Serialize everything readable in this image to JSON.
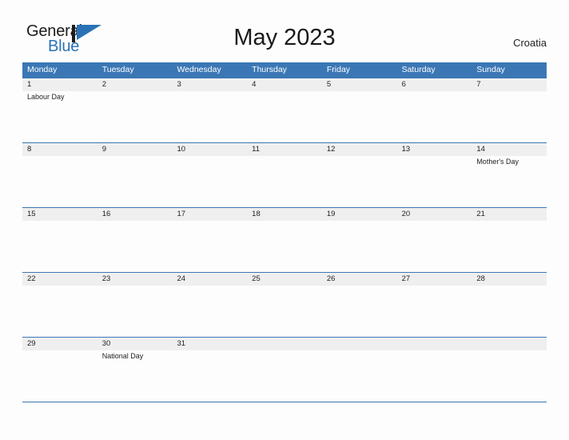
{
  "brand": {
    "name_part1": "General",
    "name_part2": "Blue",
    "flag_icon": "blue-flag-triangle-icon",
    "accent_color": "#2a72b5"
  },
  "header": {
    "title": "May 2023",
    "country": "Croatia"
  },
  "colors": {
    "header_blue": "#3b77b5",
    "daynum_band_gray": "#efefef",
    "page_background": "#fdfdfd",
    "text_dark": "#1f1f1f",
    "text_white": "#ffffff"
  },
  "calendar": {
    "month": "May",
    "year": "2023",
    "weekday_headers": [
      "Monday",
      "Tuesday",
      "Wednesday",
      "Thursday",
      "Friday",
      "Saturday",
      "Sunday"
    ],
    "weeks": [
      {
        "days": [
          {
            "num": "1",
            "event": "Labour Day"
          },
          {
            "num": "2",
            "event": ""
          },
          {
            "num": "3",
            "event": ""
          },
          {
            "num": "4",
            "event": ""
          },
          {
            "num": "5",
            "event": ""
          },
          {
            "num": "6",
            "event": ""
          },
          {
            "num": "7",
            "event": ""
          }
        ]
      },
      {
        "days": [
          {
            "num": "8",
            "event": ""
          },
          {
            "num": "9",
            "event": ""
          },
          {
            "num": "10",
            "event": ""
          },
          {
            "num": "11",
            "event": ""
          },
          {
            "num": "12",
            "event": ""
          },
          {
            "num": "13",
            "event": ""
          },
          {
            "num": "14",
            "event": "Mother's Day"
          }
        ]
      },
      {
        "days": [
          {
            "num": "15",
            "event": ""
          },
          {
            "num": "16",
            "event": ""
          },
          {
            "num": "17",
            "event": ""
          },
          {
            "num": "18",
            "event": ""
          },
          {
            "num": "19",
            "event": ""
          },
          {
            "num": "20",
            "event": ""
          },
          {
            "num": "21",
            "event": ""
          }
        ]
      },
      {
        "days": [
          {
            "num": "22",
            "event": ""
          },
          {
            "num": "23",
            "event": ""
          },
          {
            "num": "24",
            "event": ""
          },
          {
            "num": "25",
            "event": ""
          },
          {
            "num": "26",
            "event": ""
          },
          {
            "num": "27",
            "event": ""
          },
          {
            "num": "28",
            "event": ""
          }
        ]
      },
      {
        "days": [
          {
            "num": "29",
            "event": ""
          },
          {
            "num": "30",
            "event": "National Day"
          },
          {
            "num": "31",
            "event": ""
          },
          {
            "num": "",
            "event": ""
          },
          {
            "num": "",
            "event": ""
          },
          {
            "num": "",
            "event": ""
          },
          {
            "num": "",
            "event": ""
          }
        ]
      }
    ]
  }
}
